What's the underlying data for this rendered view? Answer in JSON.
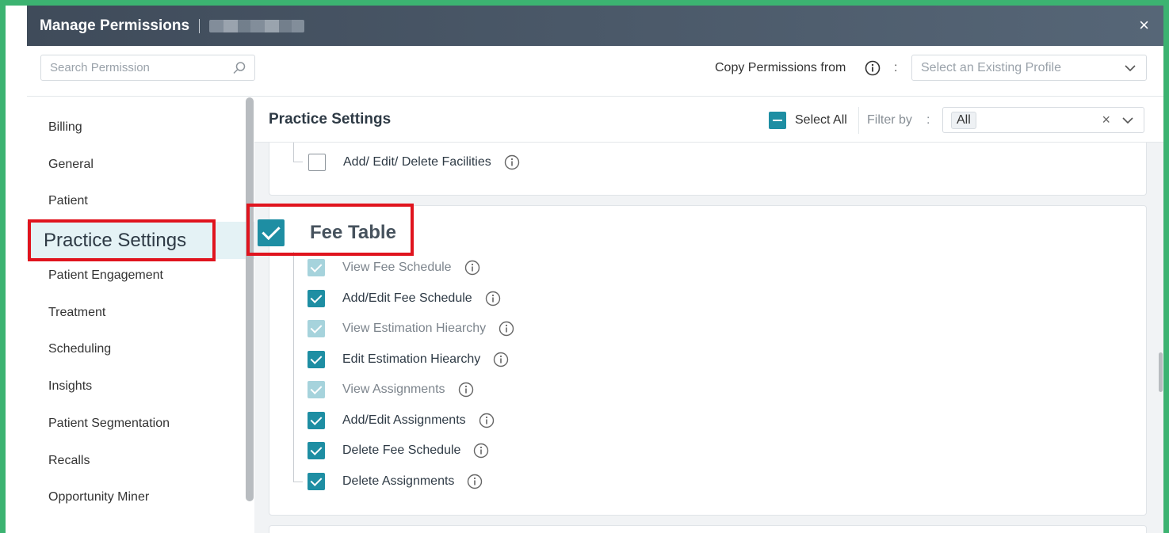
{
  "header": {
    "title": "Manage Permissions",
    "close_label": "×"
  },
  "toolbar": {
    "search_placeholder": "Search Permission",
    "copy_label": "Copy Permissions from",
    "copy_colon": ":",
    "profile_placeholder": "Select an Existing Profile"
  },
  "sidebar": {
    "items": [
      {
        "label": "Billing"
      },
      {
        "label": "General"
      },
      {
        "label": "Patient"
      },
      {
        "label": "Practice Settings",
        "active": true
      },
      {
        "label": "Patient Engagement"
      },
      {
        "label": "Treatment"
      },
      {
        "label": "Scheduling"
      },
      {
        "label": "Insights"
      },
      {
        "label": "Patient Segmentation"
      },
      {
        "label": "Recalls"
      },
      {
        "label": "Opportunity Miner"
      }
    ]
  },
  "main": {
    "title": "Practice Settings",
    "select_all_label": "Select All",
    "filter_label": "Filter by",
    "filter_colon": ":",
    "filter_value": "All",
    "filter_clear": "×"
  },
  "facilities": {
    "label": "Add/ Edit/ Delete Facilities",
    "checked": false
  },
  "fee_table": {
    "title": "Fee Table",
    "checked": true,
    "permissions": [
      {
        "label": "View Fee Schedule",
        "state": "dim"
      },
      {
        "label": "Add/Edit Fee Schedule",
        "state": "on"
      },
      {
        "label": "View Estimation Hiearchy",
        "state": "dim"
      },
      {
        "label": "Edit Estimation Hiearchy",
        "state": "on"
      },
      {
        "label": "View Assignments",
        "state": "dim"
      },
      {
        "label": "Add/Edit Assignments",
        "state": "on"
      },
      {
        "label": "Delete Fee Schedule",
        "state": "on"
      },
      {
        "label": "Delete Assignments",
        "state": "on"
      }
    ]
  },
  "colors": {
    "accent": "#1e8ea3",
    "highlight_border": "#e0141e",
    "frame": "#3cb371",
    "header_bg": "#3f4b5a"
  }
}
